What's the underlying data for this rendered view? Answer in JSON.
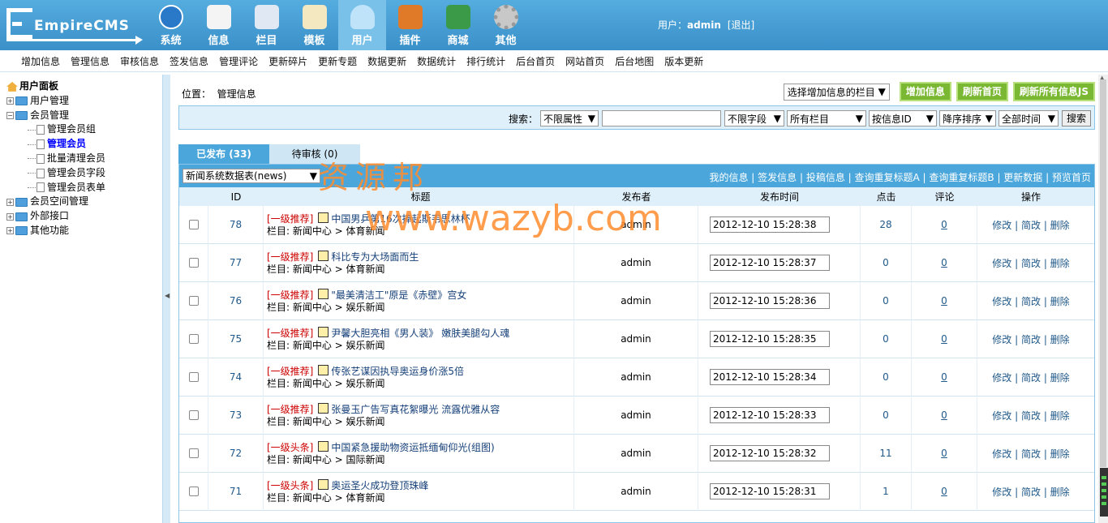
{
  "app": {
    "logo": "EmpireCMS"
  },
  "topnav": [
    {
      "label": "系统",
      "icon": "globe-icon"
    },
    {
      "label": "信息",
      "icon": "document-edit-icon"
    },
    {
      "label": "栏目",
      "icon": "folder-icon"
    },
    {
      "label": "模板",
      "icon": "template-icon"
    },
    {
      "label": "用户",
      "icon": "user-icon",
      "active": true
    },
    {
      "label": "插件",
      "icon": "tools-icon"
    },
    {
      "label": "商城",
      "icon": "shop-card-icon"
    },
    {
      "label": "其他",
      "icon": "gear-icon"
    }
  ],
  "user": {
    "prefix": "用户：",
    "name": "admin",
    "logout": "[退出]"
  },
  "subnav": [
    "增加信息",
    "管理信息",
    "审核信息",
    "签发信息",
    "管理评论",
    "更新碎片",
    "更新专题",
    "数据更新",
    "数据统计",
    "排行统计",
    "后台首页",
    "网站首页",
    "后台地图",
    "版本更新"
  ],
  "sidebar": {
    "title": "用户面板",
    "items": [
      {
        "label": "用户管理",
        "level": 0,
        "expanded": false
      },
      {
        "label": "会员管理",
        "level": 0,
        "expanded": true
      },
      {
        "label": "管理会员组",
        "level": 1
      },
      {
        "label": "管理会员",
        "level": 1,
        "selected": true
      },
      {
        "label": "批量清理会员",
        "level": 1
      },
      {
        "label": "管理会员字段",
        "level": 1
      },
      {
        "label": "管理会员表单",
        "level": 1
      },
      {
        "label": "会员空间管理",
        "level": 0,
        "expanded": false
      },
      {
        "label": "外部接口",
        "level": 0,
        "expanded": false
      },
      {
        "label": "其他功能",
        "level": 0,
        "expanded": false
      }
    ]
  },
  "main": {
    "position_label": "位置：",
    "position_value": "管理信息",
    "column_select": "选择增加信息的栏目",
    "buttons": {
      "add": "增加信息",
      "refresh_home": "刷新首页",
      "refresh_js": "刷新所有信息JS"
    },
    "search": {
      "label": "搜索：",
      "attr": "不限属性",
      "field": "不限字段",
      "column": "所有栏目",
      "order_by": "按信息ID",
      "order": "降序排序",
      "time": "全部时间",
      "button": "搜索"
    },
    "tabs": {
      "published": "已发布 (33)",
      "pending": "待审核 (0)"
    },
    "table_select": "新闻系统数据表(news)",
    "header_links": [
      "我的信息",
      "签发信息",
      "投稿信息",
      "查询重复标题A",
      "查询重复标题B",
      "更新数据",
      "预览首页"
    ],
    "columns": [
      "ID",
      "标题",
      "发布者",
      "发布时间",
      "点击",
      "评论",
      "操作"
    ],
    "rows": [
      {
        "id": "78",
        "tag": "[一级推荐]",
        "title": "中国男乒第16次捧起斯韦思林杯",
        "cat": "栏目: 新闻中心 > 体育新闻",
        "author": "admin",
        "time": "2012-12-10 15:28:38",
        "clicks": "28",
        "comments": "0"
      },
      {
        "id": "77",
        "tag": "[一级推荐]",
        "title": "科比专为大场面而生",
        "cat": "栏目: 新闻中心 > 体育新闻",
        "author": "admin",
        "time": "2012-12-10 15:28:37",
        "clicks": "0",
        "comments": "0"
      },
      {
        "id": "76",
        "tag": "[一级推荐]",
        "title": "\"最美清洁工\"原是《赤壁》宫女",
        "cat": "栏目: 新闻中心 > 娱乐新闻",
        "author": "admin",
        "time": "2012-12-10 15:28:36",
        "clicks": "0",
        "comments": "0"
      },
      {
        "id": "75",
        "tag": "[一级推荐]",
        "title": "尹馨大胆亮相《男人装》 嫩肤美腿勾人魂",
        "cat": "栏目: 新闻中心 > 娱乐新闻",
        "author": "admin",
        "time": "2012-12-10 15:28:35",
        "clicks": "0",
        "comments": "0"
      },
      {
        "id": "74",
        "tag": "[一级推荐]",
        "title": "传张艺谋因执导奥运身价涨5倍",
        "cat": "栏目: 新闻中心 > 娱乐新闻",
        "author": "admin",
        "time": "2012-12-10 15:28:34",
        "clicks": "0",
        "comments": "0"
      },
      {
        "id": "73",
        "tag": "[一级推荐]",
        "title": "张曼玉广告写真花絮曝光 流露优雅从容",
        "cat": "栏目: 新闻中心 > 娱乐新闻",
        "author": "admin",
        "time": "2012-12-10 15:28:33",
        "clicks": "0",
        "comments": "0"
      },
      {
        "id": "72",
        "tag": "[一级头条]",
        "title": "中国紧急援助物资运抵缅甸仰光(组图)",
        "cat": "栏目: 新闻中心 > 国际新闻",
        "author": "admin",
        "time": "2012-12-10 15:28:32",
        "clicks": "11",
        "comments": "0"
      },
      {
        "id": "71",
        "tag": "[一级头条]",
        "title": "奥运圣火成功登顶珠峰",
        "cat": "栏目: 新闻中心 > 体育新闻",
        "author": "admin",
        "time": "2012-12-10 15:28:31",
        "clicks": "1",
        "comments": "0"
      }
    ],
    "ops": {
      "edit": "修改",
      "quick_edit": "简改",
      "delete": "删除",
      "sep": " | "
    }
  },
  "watermark": {
    "cn": "资源邦",
    "url": "www.wazyb.com"
  }
}
